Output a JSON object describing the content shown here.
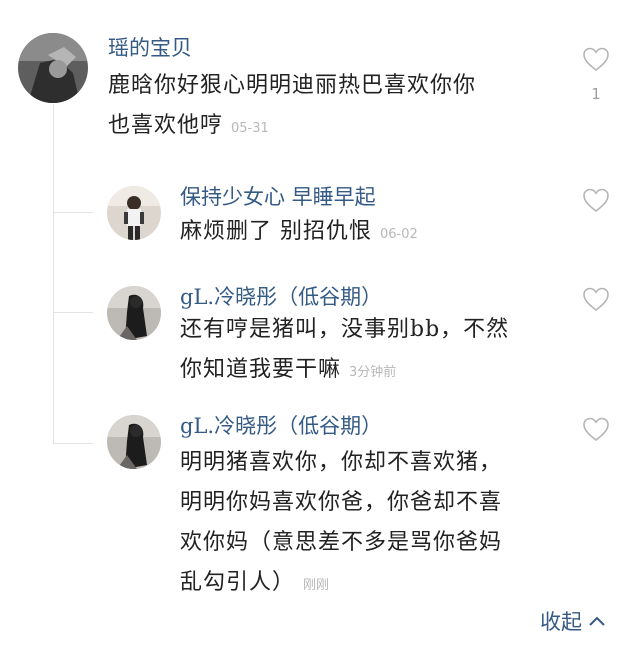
{
  "comment": {
    "username": "瑶的宝贝",
    "text_lines": [
      "鹿晗你好狠心明明迪丽热巴喜欢你你",
      "也喜欢他哼"
    ],
    "time": "05-31",
    "like_count": "1",
    "avatar_icon": "avatar-grayscale"
  },
  "replies": [
    {
      "username": "保持少女心 早睡早起",
      "text_lines": [
        "麻烦删了 别招仇恨"
      ],
      "time": "06-02",
      "avatar_icon": "avatar-girl-photo"
    },
    {
      "username": "gL.冷晓彤（低谷期）",
      "text_lines": [
        "还有哼是猪叫，没事别bb，不然",
        "你知道我要干嘛"
      ],
      "time": "3分钟前",
      "avatar_icon": "avatar-dark-photo"
    },
    {
      "username": "gL.冷晓彤（低谷期）",
      "text_lines": [
        "明明猪喜欢你，你却不喜欢猪，",
        "明明你妈喜欢你爸，你爸却不喜",
        "欢你妈（意思差不多是骂你爸妈",
        "乱勾引人）"
      ],
      "time": "刚刚",
      "avatar_icon": "avatar-dark-photo"
    }
  ],
  "collapse_label": "收起",
  "colors": {
    "username": "#345a86",
    "text": "#222222",
    "time": "#b8b8b8",
    "thread_line": "#e3e3e3"
  }
}
